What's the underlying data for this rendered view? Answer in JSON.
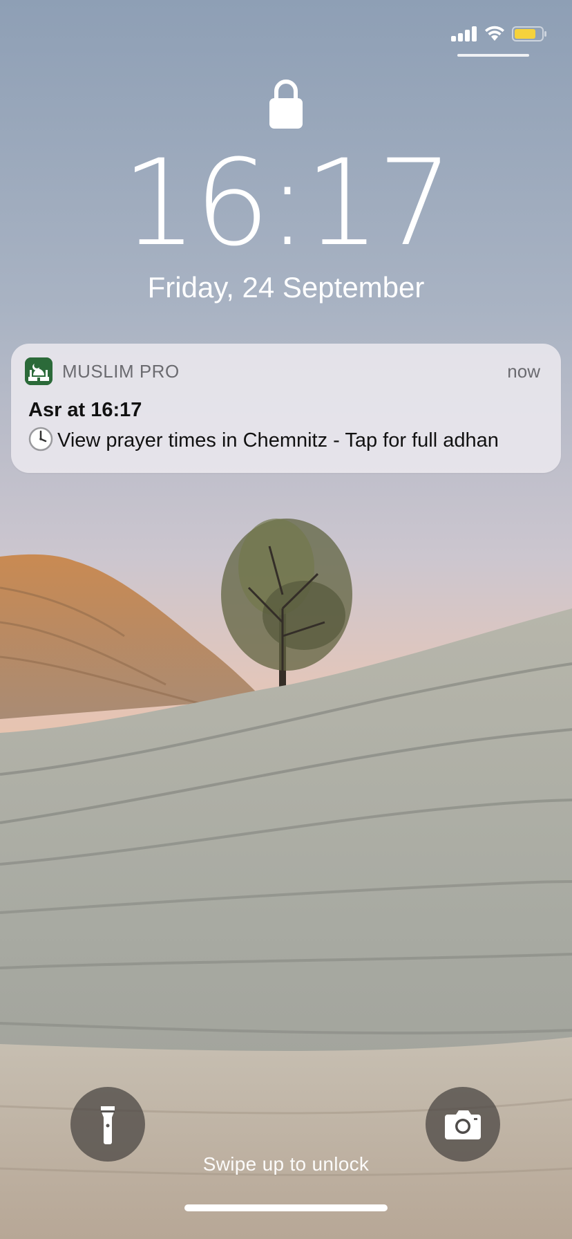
{
  "status_bar": {
    "signal_icon": "cellular-signal-icon",
    "wifi_icon": "wifi-icon",
    "battery_icon": "battery-icon",
    "battery_color": "#f5d23c"
  },
  "lock_screen": {
    "lock_icon": "lock-icon",
    "time": "16:17",
    "date": "Friday, 24 September"
  },
  "notification": {
    "app_icon": "muslim-pro-app-icon",
    "app_name": "MUSLIM PRO",
    "time": "now",
    "title": "Asr at 16:17",
    "body_icon": "clock-emoji",
    "body": "View prayer times in Chemnitz - Tap for full adhan"
  },
  "controls": {
    "flashlight_icon": "flashlight-icon",
    "camera_icon": "camera-icon",
    "swipe_hint": "Swipe up to unlock"
  },
  "colors": {
    "app_icon_green": "#2b6a39",
    "notification_bg": "#eae8ee"
  }
}
